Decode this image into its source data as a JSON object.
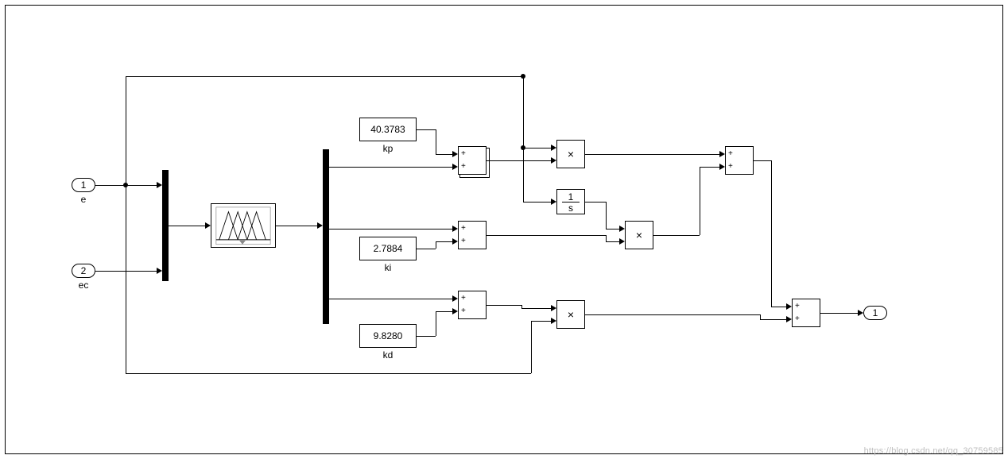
{
  "inports": {
    "e": {
      "number": "1",
      "label": "e"
    },
    "ec": {
      "number": "2",
      "label": "ec"
    }
  },
  "outport": {
    "number": "1"
  },
  "constants": {
    "kp": {
      "value": "40.3783",
      "label": "kp"
    },
    "ki": {
      "value": "2.7884",
      "label": "ki"
    },
    "kd": {
      "value": "9.8280",
      "label": "kd"
    }
  },
  "blocks": {
    "integrator": {
      "num": "1",
      "den": "s"
    },
    "product_glyph": "×",
    "sum_sign": "+"
  },
  "watermark": "https://blog.csdn.net/qq_30759585"
}
